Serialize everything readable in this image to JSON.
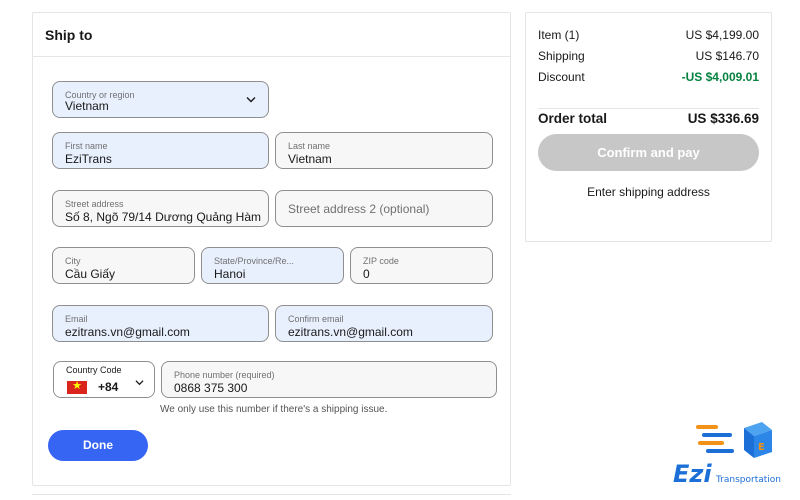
{
  "form": {
    "title": "Ship to",
    "country": {
      "label": "Country or region",
      "value": "Vietnam"
    },
    "first_name": {
      "label": "First name",
      "value": "EziTrans"
    },
    "last_name": {
      "label": "Last name",
      "value": "Vietnam"
    },
    "street": {
      "label": "Street address",
      "value": "Số 8, Ngõ 79/14 Dương Quảng Hàm"
    },
    "street2": {
      "placeholder": "Street address 2 (optional)"
    },
    "city": {
      "label": "City",
      "value": "Cầu Giấy"
    },
    "state": {
      "label": "State/Province/Re...",
      "value": "Hanoi"
    },
    "zip": {
      "label": "ZIP code",
      "value": "0"
    },
    "email": {
      "label": "Email",
      "value": "ezitrans.vn@gmail.com"
    },
    "confirm_email": {
      "label": "Confirm email",
      "value": "ezitrans.vn@gmail.com"
    },
    "country_code": {
      "label": "Country Code",
      "value": "+84"
    },
    "phone": {
      "label": "Phone number (required)",
      "value": "0868 375 300"
    },
    "phone_hint": "We only use this number if there's a shipping issue.",
    "done_label": "Done"
  },
  "summary": {
    "item_label": "Item (1)",
    "item_value": "US $4,199.00",
    "shipping_label": "Shipping",
    "shipping_value": "US $146.70",
    "discount_label": "Discount",
    "discount_value": "-US $4,009.01",
    "total_label": "Order total",
    "total_value": "US $336.69",
    "confirm_label": "Confirm and pay",
    "enter_address": "Enter shipping address"
  },
  "logo": {
    "brand": "Ezi",
    "tagline": "Transportation"
  },
  "colors": {
    "primary": "#3665f3",
    "discount": "#05823f",
    "disabled": "#c7c7c7",
    "filled_bg": "#e8f0fe"
  },
  "icons": {
    "dropdown": "chevron-down-icon",
    "flag": "vietnam-flag-icon"
  }
}
